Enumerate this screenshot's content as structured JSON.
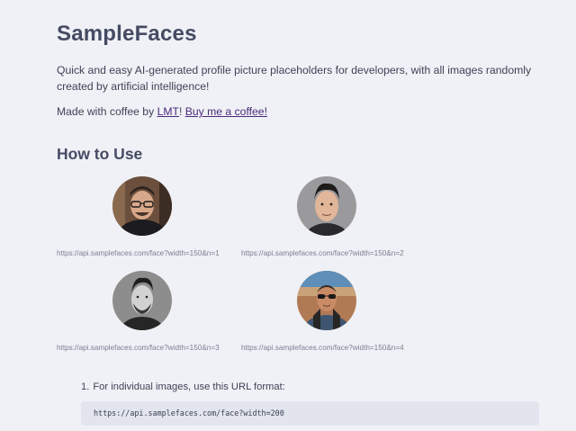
{
  "page": {
    "title": "SampleFaces",
    "intro": "Quick and easy AI-generated profile picture placeholders for developers, with all images randomly created by artificial intelligence!",
    "credit": {
      "prefix": "Made with coffee by ",
      "author_link": "LMT",
      "separator": "! ",
      "coffee_link": "Buy me a coffee!"
    }
  },
  "how_to_use": {
    "heading": "How to Use",
    "examples": [
      {
        "url": "https://api.samplefaces.com/face?width=150&n=1",
        "icon": "avatar-face-glasses"
      },
      {
        "url": "https://api.samplefaces.com/face?width=150&n=2",
        "icon": "avatar-face-dark-hair"
      },
      {
        "url": "https://api.samplefaces.com/face?width=150&n=3",
        "icon": "avatar-face-bw"
      },
      {
        "url": "https://api.samplefaces.com/face?width=150&n=4",
        "icon": "avatar-face-sunglasses"
      }
    ],
    "steps": [
      {
        "number": "1.",
        "text": "For individual images, use this URL format:"
      }
    ],
    "code_example": "https://api.samplefaces.com/face?width=200"
  },
  "colors": {
    "background": "#eff1f6",
    "heading": "#454b63",
    "link": "#4a2a7a",
    "code_bg": "#e2e5ee"
  }
}
